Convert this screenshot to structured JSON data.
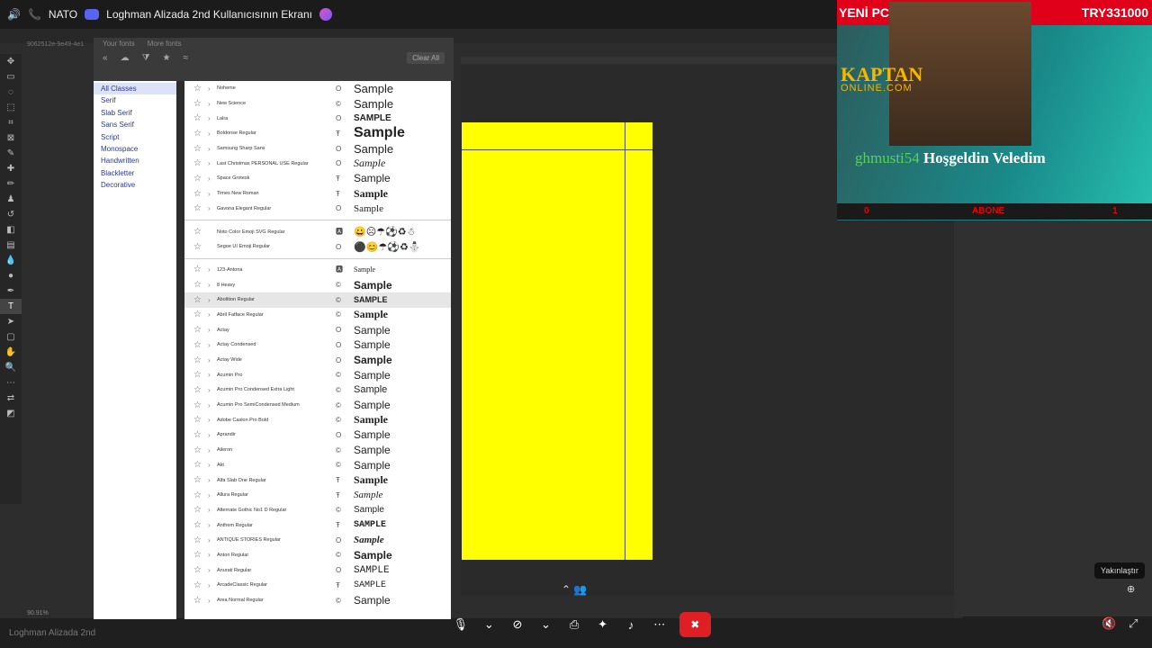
{
  "top_bar": {
    "server_name": "NATO",
    "window_title": "Loghman Alizada 2nd Kullanıcısının Ekranı"
  },
  "photoshop": {
    "doc_tab": "9062512e-9e49-4e1",
    "zoom_pct": "90.91%",
    "canvas_color": "#ffff00"
  },
  "font_panel": {
    "tabs": [
      "Your fonts",
      "More fonts"
    ],
    "clear_all": "Clear All",
    "classes": [
      "All Classes",
      "Serif",
      "Slab Serif",
      "Sans Serif",
      "Script",
      "Monospace",
      "Handwritten",
      "Blackletter",
      "Decorative"
    ],
    "fonts_group1": [
      {
        "name": "Noheme",
        "type": "O",
        "sample": "Sample",
        "fs": 13,
        "fw": "normal",
        "ff": "Liberation Sans"
      },
      {
        "name": "New Science",
        "type": "©",
        "sample": "Sample",
        "fs": 13,
        "fw": "normal",
        "ff": "Liberation Sans"
      },
      {
        "name": "Lalra",
        "type": "O",
        "sample": "SAMPLE",
        "fs": 10,
        "fw": "bold",
        "ff": "Liberation Sans"
      },
      {
        "name": "Boldonse Regular",
        "type": "Ŧ",
        "sample": "Sample",
        "fs": 16,
        "fw": "bold",
        "ff": "Liberation Sans"
      },
      {
        "name": "Samsung Sharp Sans",
        "type": "O",
        "sample": "Sample",
        "fs": 13,
        "fw": "normal",
        "ff": "Liberation Sans"
      },
      {
        "name": "Last Christmas PERSONAL USE Regular",
        "type": "O",
        "sample": "Sample",
        "fs": 12,
        "fw": "normal",
        "ff": "Liberation Serif",
        "it": true
      },
      {
        "name": "Space Grotesk",
        "type": "Ŧ",
        "sample": "Sample",
        "fs": 12,
        "fw": "normal",
        "ff": "Liberation Sans"
      },
      {
        "name": "Times New Roman",
        "type": "Ŧ",
        "sample": "Sample",
        "fs": 12,
        "fw": "bold",
        "ff": "Liberation Serif"
      },
      {
        "name": "Gavona Elegant Regular",
        "type": "O",
        "sample": "Sample",
        "fs": 11,
        "fw": "normal",
        "ff": "Liberation Serif"
      }
    ],
    "fonts_emoji": [
      {
        "name": "Noto Color Emoji SVG Regular",
        "type": "🅰",
        "sample": "😀☹☂⚽♻☃"
      },
      {
        "name": "Segoe UI Emoji Regular",
        "type": "O",
        "sample": "⚫😊☂⚽♻⛄"
      }
    ],
    "fonts_group2": [
      {
        "name": "123-Antona",
        "type": "🅰",
        "sample": "Sample",
        "fs": 8,
        "fw": "normal",
        "ff": "Liberation Serif"
      },
      {
        "name": "8 Heavy",
        "type": "©",
        "sample": "Sample",
        "fs": 12,
        "fw": "bold",
        "ff": "Liberation Sans"
      },
      {
        "name": "Abolition Regular",
        "type": "©",
        "sample": "SAMPLE",
        "fs": 9,
        "fw": "bold",
        "ff": "Liberation Sans"
      },
      {
        "name": "Abril Fatface Regular",
        "type": "©",
        "sample": "Sample",
        "fs": 12,
        "fw": "bold",
        "ff": "Liberation Serif"
      },
      {
        "name": "Actay",
        "type": "O",
        "sample": "Sample",
        "fs": 12,
        "fw": "normal",
        "ff": "Liberation Sans"
      },
      {
        "name": "Actay Condensed",
        "type": "O",
        "sample": "Sample",
        "fs": 12,
        "fw": "normal",
        "ff": "Liberation Sans"
      },
      {
        "name": "Actay Wide",
        "type": "O",
        "sample": "Sample",
        "fs": 12,
        "fw": "bold",
        "ff": "Liberation Sans"
      },
      {
        "name": "Acumin Pro",
        "type": "©",
        "sample": "Sample",
        "fs": 12,
        "fw": "normal",
        "ff": "Liberation Sans"
      },
      {
        "name": "Acumin Pro Condensed Extra Light",
        "type": "©",
        "sample": "Sample",
        "fs": 11,
        "fw": "normal",
        "ff": "Liberation Sans"
      },
      {
        "name": "Acumin Pro SemiCondensed Medium",
        "type": "©",
        "sample": "Sample",
        "fs": 12,
        "fw": "normal",
        "ff": "Liberation Sans"
      },
      {
        "name": "Adobe Caslon Pro Bold",
        "type": "©",
        "sample": "Sample",
        "fs": 12,
        "fw": "bold",
        "ff": "Liberation Serif"
      },
      {
        "name": "Aprandir",
        "type": "O",
        "sample": "Sample",
        "fs": 12,
        "fw": "normal",
        "ff": "Liberation Sans"
      },
      {
        "name": "Aileron",
        "type": "©",
        "sample": "Sample",
        "fs": 12,
        "fw": "normal",
        "ff": "Liberation Sans"
      },
      {
        "name": "Akt",
        "type": "©",
        "sample": "Sample",
        "fs": 12,
        "fw": "normal",
        "ff": "Liberation Sans"
      },
      {
        "name": "Alfa Slab One Regular",
        "type": "Ŧ",
        "sample": "Sample",
        "fs": 12,
        "fw": "bold",
        "ff": "Liberation Serif"
      },
      {
        "name": "Allura Regular",
        "type": "Ŧ",
        "sample": "Sample",
        "fs": 11,
        "fw": "normal",
        "ff": "Liberation Serif",
        "it": true
      },
      {
        "name": "Alternate Gothic No1 D Regular",
        "type": "©",
        "sample": "Sample",
        "fs": 10,
        "fw": "normal",
        "ff": "Liberation Sans"
      },
      {
        "name": "Anthem Regular",
        "type": "Ŧ",
        "sample": "SAMPLE",
        "fs": 10,
        "fw": "bold",
        "ff": "Liberation Mono"
      },
      {
        "name": "ANTIQUE STORIES Regular",
        "type": "O",
        "sample": "Sample",
        "fs": 11,
        "fw": "bold",
        "ff": "Liberation Serif",
        "it": true
      },
      {
        "name": "Anton Regular",
        "type": "©",
        "sample": "Sample",
        "fs": 12,
        "fw": "bold",
        "ff": "Liberation Sans"
      },
      {
        "name": "Anurati Regular",
        "type": "O",
        "sample": "SAMPLE",
        "fs": 11,
        "fw": "normal",
        "ff": "Liberation Mono"
      },
      {
        "name": "ArcadeClassic Regular",
        "type": "Ŧ",
        "sample": "SAMPLE",
        "fs": 10,
        "fw": "normal",
        "ff": "Liberation Mono"
      },
      {
        "name": "Area Normal Regular",
        "type": "©",
        "sample": "Sample",
        "fs": 12,
        "fw": "normal",
        "ff": "Liberation Sans"
      }
    ]
  },
  "stream": {
    "top_left": "YENİ PC",
    "top_right": "TRY331000",
    "logo_line1": "KAPTAN",
    "logo_line2": "ONLINE.COM",
    "chat_user": "ghmusti54",
    "chat_message": "Hoşgeldin Veledim",
    "bar_left": "0",
    "bar_mid": "ABONE",
    "bar_right": "1"
  },
  "call": {
    "tooltip": "Yakınlaştır",
    "bottom_label": "Loghman Alizada 2nd"
  }
}
